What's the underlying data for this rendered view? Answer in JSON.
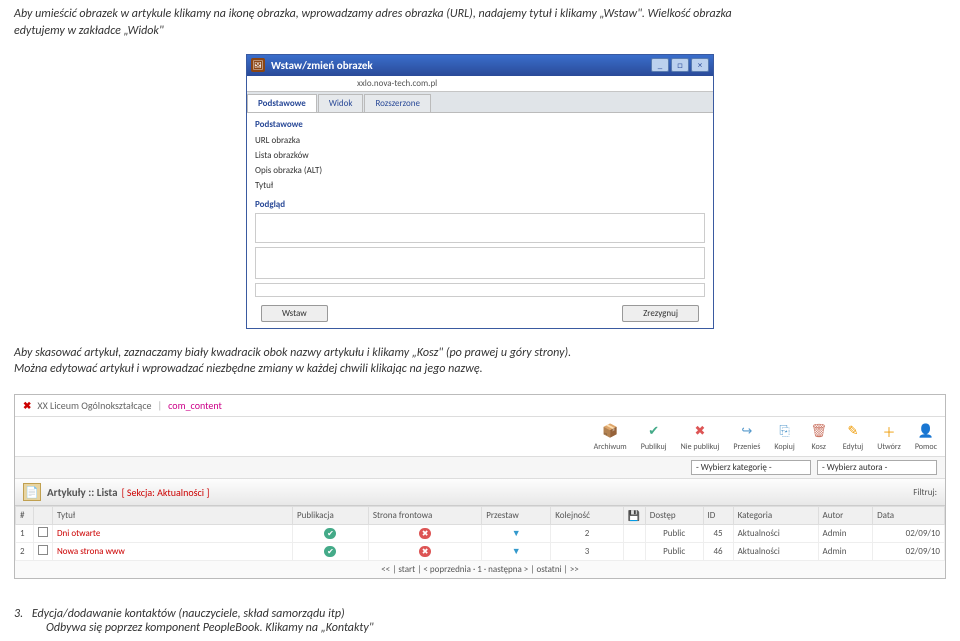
{
  "para1_a": "Aby umieścić obrazek w artykule klikamy na ikonę obrazka, wprowadzamy adres obrazka (URL), nadajemy tytuł i klikamy „Wstaw\". Wielkość obrazka",
  "para1_b": "edytujemy w zakładce „Widok\"",
  "para2_a": "Aby skasować artykuł, zaznaczamy biały kwadracik obok nazwy artykułu i klikamy „Kosz\" (po prawej u góry strony).",
  "para2_b": "Można edytować  artykuł i wprowadzać niezbędne zmiany w każdej chwili klikając na jego nazwę.",
  "sec3_num": "3.",
  "sec3_a": "Edycja/dodawanie kontaktów (nauczyciele, skład samorządu itp)",
  "sec3_b": "Odbywa się poprzez komponent PeopleBook. Klikamy na „Kontakty\"",
  "dialog": {
    "title": "Wstaw/zmień obrazek",
    "addr": "xxlo.nova-tech.com.pl",
    "tabs": [
      "Podstawowe",
      "Widok",
      "Rozszerzone"
    ],
    "group_podst": "Podstawowe",
    "field_url": "URL obrazka",
    "field_lista": "Lista obrazków",
    "field_alt": "Opis obrazka (ALT)",
    "field_tytul": "Tytuł",
    "group_podglad": "Podgląd",
    "btn_wstaw": "Wstaw",
    "btn_zrezyg": "Zrezygnuj",
    "winbtn_min": "_",
    "winbtn_max": "□",
    "winbtn_close": "×"
  },
  "toolbar": {
    "crumb1": "XX Liceum Ogólnokształcące",
    "crumb2": "com_content",
    "items": [
      {
        "label": "Archiwum",
        "g": "📦",
        "c": "#8b5"
      },
      {
        "label": "Publikuj",
        "g": "✔",
        "c": "#4a8"
      },
      {
        "label": "Nie publikuj",
        "g": "✖",
        "c": "#d55"
      },
      {
        "label": "Przenieś",
        "g": "↪",
        "c": "#59c"
      },
      {
        "label": "Kopiuj",
        "g": "⎘",
        "c": "#59c"
      },
      {
        "label": "Kosz",
        "g": "🗑",
        "c": "#c76"
      },
      {
        "label": "Edytuj",
        "g": "✎",
        "c": "#e90"
      },
      {
        "label": "Utwórz",
        "g": "＋",
        "c": "#e90"
      },
      {
        "label": "Pomoc",
        "g": "👤",
        "c": "#d66"
      }
    ],
    "sel1": "- Wybierz kategorię -",
    "sel2": "- Wybierz autora -",
    "list_title": "Artykuły :: Lista",
    "list_sek": "[ Sekcja: Aktualności ]",
    "filtruj": "Filtruj:",
    "pic_glyph": "📄"
  },
  "grid": {
    "headers": [
      "#",
      "",
      "Tytuł",
      "Publikacja",
      "Strona frontowa",
      "Przestaw",
      "Kolejność",
      "",
      "Dostęp",
      "ID",
      "Kategoria",
      "Autor",
      "Data"
    ],
    "rows": [
      {
        "n": "1",
        "title": "Dni otwarte",
        "ord": "2",
        "dostep": "Public",
        "id": "45",
        "kat": "Aktualności",
        "autor": "Admin",
        "data": "02/09/10"
      },
      {
        "n": "2",
        "title": "Nowa strona www",
        "ord": "3",
        "dostep": "Public",
        "id": "46",
        "kat": "Aktualności",
        "autor": "Admin",
        "data": "02/09/10"
      }
    ],
    "pager": "<< | start | < poprzednia · 1 · następna > | ostatni | >>",
    "save_glyph": "💾"
  }
}
